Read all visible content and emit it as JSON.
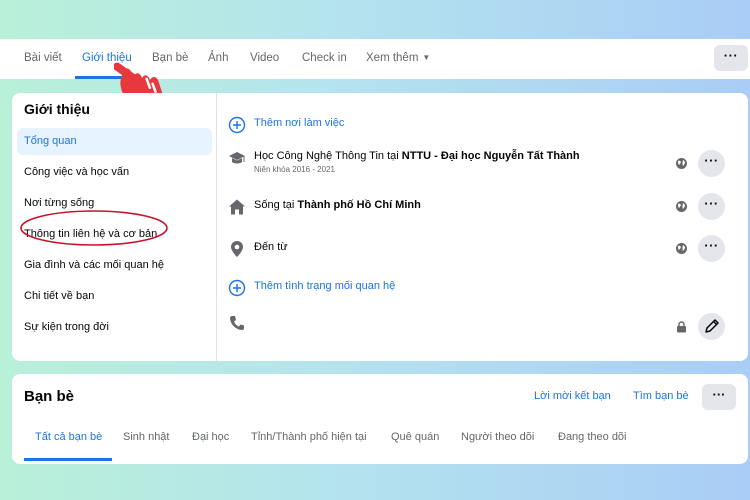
{
  "tabs": [
    {
      "label": "Bài viết",
      "active": false
    },
    {
      "label": "Giới thiệu",
      "active": true
    },
    {
      "label": "Bạn bè",
      "active": false
    },
    {
      "label": "Ảnh",
      "active": false
    },
    {
      "label": "Video",
      "active": false
    },
    {
      "label": "Check in",
      "active": false
    },
    {
      "label": "Xem thêm",
      "active": false
    }
  ],
  "more_button": "···",
  "about": {
    "title": "Giới thiệu",
    "menu": [
      {
        "label": "Tổng quan",
        "active": true
      },
      {
        "label": "Công việc và học vấn",
        "active": false
      },
      {
        "label": "Nơi từng sống",
        "active": false
      },
      {
        "label": "Thông tin liên hệ và cơ bản",
        "active": false,
        "circled": true
      },
      {
        "label": "Gia đình và các mối quan hệ",
        "active": false
      },
      {
        "label": "Chi tiết về bạn",
        "active": false
      },
      {
        "label": "Sự kiện trong đời",
        "active": false
      }
    ],
    "add_workplace": "Thêm nơi làm việc",
    "education": {
      "prefix": "Học Công Nghệ Thông Tin tại ",
      "school": "NTTU - Đại học Nguyễn Tất Thành",
      "years": "Niên khóa 2016 - 2021"
    },
    "lives_in": {
      "prefix": "Sống tại ",
      "city": "Thành phố Hồ Chí Minh"
    },
    "from": "Đến từ",
    "add_relationship": "Thêm tình trạng mối quan hệ"
  },
  "friends": {
    "title": "Bạn bè",
    "requests_link": "Lời mời kết bạn",
    "find_link": "Tìm bạn bè",
    "tabs": [
      {
        "label": "Tất cả bạn bè",
        "active": true
      },
      {
        "label": "Sinh nhật",
        "active": false
      },
      {
        "label": "Đại học",
        "active": false
      },
      {
        "label": "Tỉnh/Thành phố hiện tại",
        "active": false
      },
      {
        "label": "Quê quán",
        "active": false
      },
      {
        "label": "Người theo dõi",
        "active": false
      },
      {
        "label": "Đang theo dõi",
        "active": false
      }
    ]
  },
  "colors": {
    "accent": "#1b74e4",
    "circle": "#c8102e",
    "hand": "#e8383d"
  }
}
